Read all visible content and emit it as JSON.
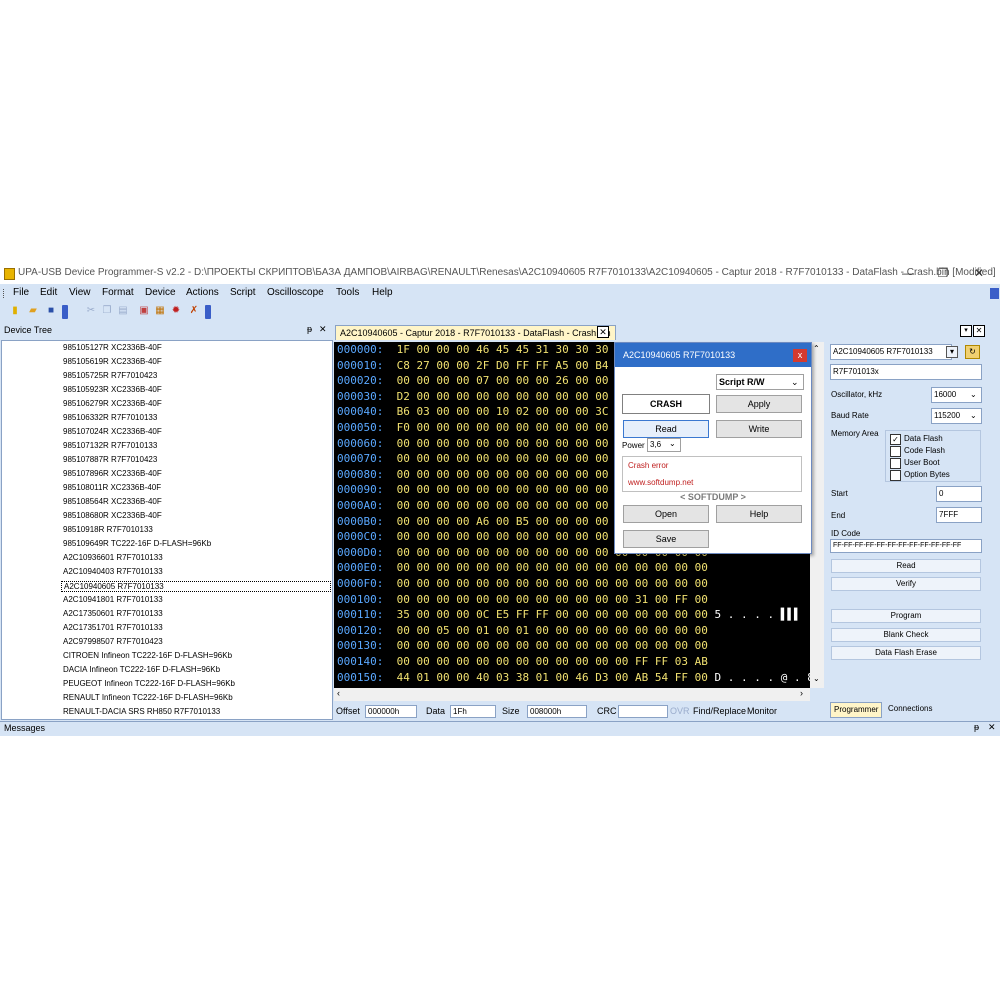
{
  "window": {
    "title": "UPA-USB Device Programmer-S v2.2 - D:\\ПРОЕКТЫ СКРИПТОВ\\БАЗА ДАМПОВ\\AIRBAG\\RENAULT\\Renesas\\A2C10940605 R7F7010133\\A2C10940605 - Captur 2018 - R7F7010133 - DataFlash - Crash.bin [Modified]",
    "minimize": "—",
    "restore": "❐",
    "close": "✕"
  },
  "menu": [
    "File",
    "Edit",
    "View",
    "Format",
    "Device",
    "Actions",
    "Script",
    "Oscilloscope",
    "Tools",
    "Help"
  ],
  "device_tree": {
    "title": "Device Tree",
    "pin": "ᵽ",
    "close": "✕",
    "items": [
      "985105127R XC2336B-40F",
      "985105619R XC2336B-40F",
      "985105725R R7F7010423",
      "985105923R XC2336B-40F",
      "985106279R XC2336B-40F",
      "985106332R R7F7010133",
      "985107024R XC2336B-40F",
      "985107132R R7F7010133",
      "985107887R R7F7010423",
      "985107896R XC2336B-40F",
      "985108011R XC2336B-40F",
      "985108564R XC2336B-40F",
      "985108680R XC2336B-40F",
      "98510918R R7F7010133",
      "985109649R TC222-16F D-FLASH=96Kb",
      "A2C10936601 R7F7010133",
      "A2C10940403 R7F7010133",
      "A2C10940605 R7F7010133",
      "A2C10941801 R7F7010133",
      "A2C17350601 R7F7010133",
      "A2C17351701 R7F7010133",
      "A2C97998507 R7F7010423",
      "CITROEN Infineon TC222-16F D-FLASH=96Kb",
      "DACIA Infineon TC222-16F D-FLASH=96Kb",
      "PEUGEOT Infineon TC222-16F D-FLASH=96Kb",
      "RENAULT Infineon TC222-16F D-FLASH=96Kb",
      "RENAULT-DACIA SRS RH850 R7F7010133"
    ],
    "selected_index": 17
  },
  "editor": {
    "tab": "A2C10940605 - Captur 2018 - R7F7010133 - DataFlash - Crash.bin",
    "tab_close": "✕",
    "rows": [
      {
        "addr": "000000:",
        "bytes": "1F 00 00 00 46 45 45 31 30 30 30",
        "ascii": ""
      },
      {
        "addr": "000010:",
        "bytes": "C8 27 00 00 2F D0 FF FF A5 00 B4",
        "ascii": ""
      },
      {
        "addr": "000020:",
        "bytes": "00 00 00 00 07 00 00 00 26 00 00",
        "ascii": ""
      },
      {
        "addr": "000030:",
        "bytes": "D2 00 00 00 00 00 00 00 00 00 00",
        "ascii": ""
      },
      {
        "addr": "000040:",
        "bytes": "B6 03 00 00 00 10 02 00 00 00 3C",
        "ascii": ""
      },
      {
        "addr": "000050:",
        "bytes": "F0 00 00 00 00 00 00 00 00 00 00",
        "ascii": ""
      },
      {
        "addr": "000060:",
        "bytes": "00 00 00 00 00 00 00 00 00 00 00",
        "ascii": ""
      },
      {
        "addr": "000070:",
        "bytes": "00 00 00 00 00 00 00 00 00 00 00",
        "ascii": ""
      },
      {
        "addr": "000080:",
        "bytes": "00 00 00 00 00 00 00 00 00 00 00",
        "ascii": ""
      },
      {
        "addr": "000090:",
        "bytes": "00 00 00 00 00 00 00 00 00 00 00",
        "ascii": ""
      },
      {
        "addr": "0000A0:",
        "bytes": "00 00 00 00 00 00 00 00 00 00 00",
        "ascii": ""
      },
      {
        "addr": "0000B0:",
        "bytes": "00 00 00 00 A6 00 B5 00 00 00 00",
        "ascii": ""
      },
      {
        "addr": "0000C0:",
        "bytes": "00 00 00 00 00 00 00 00 00 00 00",
        "ascii": ""
      },
      {
        "addr": "0000D0:",
        "bytes": "00 00 00 00 00 00 00 00 00 00 00 00 00 00 00 00",
        "ascii": ""
      },
      {
        "addr": "0000E0:",
        "bytes": "00 00 00 00 00 00 00 00 00 00 00 00 00 00 00 00",
        "ascii": ""
      },
      {
        "addr": "0000F0:",
        "bytes": "00 00 00 00 00 00 00 00 00 00 00 00 00 00 00 00",
        "ascii": ""
      },
      {
        "addr": "000100:",
        "bytes": "00 00 00 00 00 00 00 00 00 00 00 00 31 00 FF 00",
        "ascii": ""
      },
      {
        "addr": "000110:",
        "bytes": "35 00 00 00 0C E5 FF FF 00 00 00 00 00 00 00 00",
        "ascii": "5 . . . . ▌▌▌"
      },
      {
        "addr": "000120:",
        "bytes": "00 00 05 00 01 00 01 00 00 00 00 00 00 00 00 00",
        "ascii": ""
      },
      {
        "addr": "000130:",
        "bytes": "00 00 00 00 00 00 00 00 00 00 00 00 00 00 00 00",
        "ascii": ""
      },
      {
        "addr": "000140:",
        "bytes": "00 00 00 00 00 00 00 00 00 00 00 00 FF FF 03 AB",
        "ascii": ""
      },
      {
        "addr": "000150:",
        "bytes": "44 01 00 00 40 03 38 01 00 46 D3 00 AB 54 FF 00",
        "ascii": "D . . . . @ . 8"
      }
    ]
  },
  "status": {
    "offset_label": "Offset",
    "offset_value": "000000h",
    "data_label": "Data",
    "data_value": "1Fh",
    "size_label": "Size",
    "size_value": "008000h",
    "crc_label": "CRC",
    "ovr": "OVR",
    "find_replace": "Find/Replace",
    "monitor": "Monitor"
  },
  "dialog": {
    "title": "A2C10940605 R7F7010133",
    "close": "x",
    "script_select": "Script R/W",
    "crash_label": "CRASH",
    "apply": "Apply",
    "read": "Read",
    "write": "Write",
    "power_label": "Power",
    "power_value": "3,6",
    "message": "Crash error",
    "url": "www.softdump.net",
    "brand": "< SOFTDUMP >",
    "open": "Open",
    "help": "Help",
    "save": "Save"
  },
  "programmer": {
    "device": "A2C10940605 R7F7010133",
    "chip": "R7F701013x",
    "oscillator_label": "Oscillator, kHz",
    "oscillator_value": "16000",
    "baud_label": "Baud Rate",
    "baud_value": "115200",
    "memory_label": "Memory Area",
    "memory_areas": [
      {
        "label": "Data Flash",
        "checked": true
      },
      {
        "label": "Code Flash",
        "checked": false
      },
      {
        "label": "User Boot",
        "checked": false
      },
      {
        "label": "Option Bytes",
        "checked": false
      }
    ],
    "start_label": "Start",
    "start_value": "0",
    "end_label": "End",
    "end_value": "7FFF",
    "id_label": "ID Code",
    "id_value": "FF-FF-FF-FF-FF-FF-FF-FF-FF-FF-FF-FF",
    "read": "Read",
    "verify": "Verify",
    "program": "Program",
    "blank_check": "Blank Check",
    "data_flash_erase": "Data Flash Erase",
    "tab_programmer": "Programmer",
    "tab_connections": "Connections"
  },
  "messages": {
    "title": "Messages",
    "pin": "ᵽ",
    "close": "✕"
  }
}
